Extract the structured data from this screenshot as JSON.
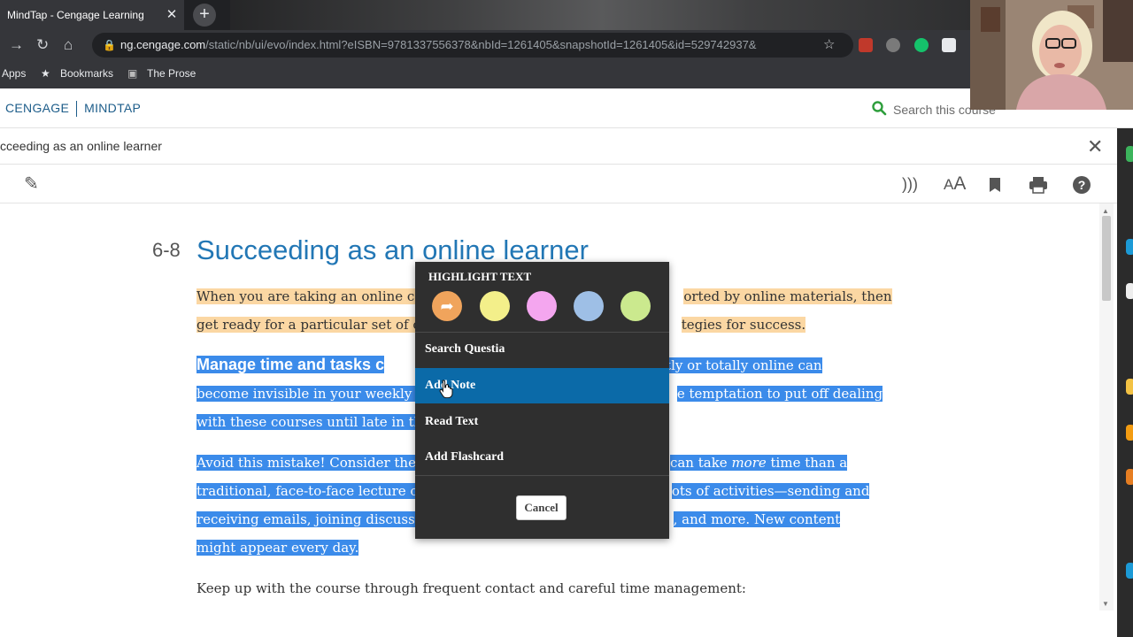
{
  "browser": {
    "tab_title": "MindTap - Cengage Learning",
    "tab_close": "✕",
    "new_tab": "+",
    "url_host": "ng.cengage.com",
    "url_path": "/static/nb/ui/evo/index.html?eISBN=9781337556378&nbId=1261405&snapshotId=1261405&id=529742937&",
    "bookmarks": {
      "apps": "Apps",
      "bookmarks": "Bookmarks",
      "the_prose": "The Prose"
    }
  },
  "app": {
    "brand_left": "CENGAGE",
    "brand_right": "MINDTAP",
    "search_placeholder": "Search this course",
    "breadcrumb": "cceeding as an online learner",
    "close": "✕"
  },
  "content": {
    "section_number": "6-8",
    "section_title": "Succeeding as an online learner",
    "p1_l1a": "When you are taking an online co",
    "p1_l1b": "orted by online materials, then",
    "p1_l2a": "get ready for a particular set of c",
    "p1_l2b": "tegies for success.",
    "p2_heading": "Manage time and tasks c",
    "p2_l1b": "mostly or totally online can",
    "p2_l2a": "become invisible in your weekly s",
    "p2_l2b": "e temptation to put off dealing",
    "p2_l3a": "with these courses until late in th",
    "p3_l1a": "Avoid this mistake! Consider the",
    "p3_l1b": "can take ",
    "p3_l1b_em": "more",
    "p3_l1c": " time than a",
    "p3_l2a": "traditional, face-to-face lecture c",
    "p3_l2b": "ots of activities—sending and",
    "p3_l3a": "receiving emails, joining discussi",
    "p3_l3b": ", and more. New content",
    "p3_l4": "might appear every day.",
    "p4": "Keep up with the course through frequent contact and careful time management:"
  },
  "popup": {
    "title": "HIGHLIGHT TEXT",
    "swatches": [
      {
        "color": "#f0a45c",
        "icon": "share-arrow-icon"
      },
      {
        "color": "#f3ef8a"
      },
      {
        "color": "#f4a6ef"
      },
      {
        "color": "#9ebfe6"
      },
      {
        "color": "#cbe98e"
      }
    ],
    "menu": [
      "Search Questia",
      "Add Note",
      "Read Text",
      "Add Flashcard"
    ],
    "active_item": "Add Note",
    "cancel": "Cancel"
  },
  "colors": {
    "brand": "#1d5d8a",
    "title_blue": "#2277b5",
    "highlight_orange": "#fbd7a3",
    "selection_blue": "#3b8bea",
    "menu_active": "#0b6aa8",
    "search_green": "#2e9e3c"
  }
}
